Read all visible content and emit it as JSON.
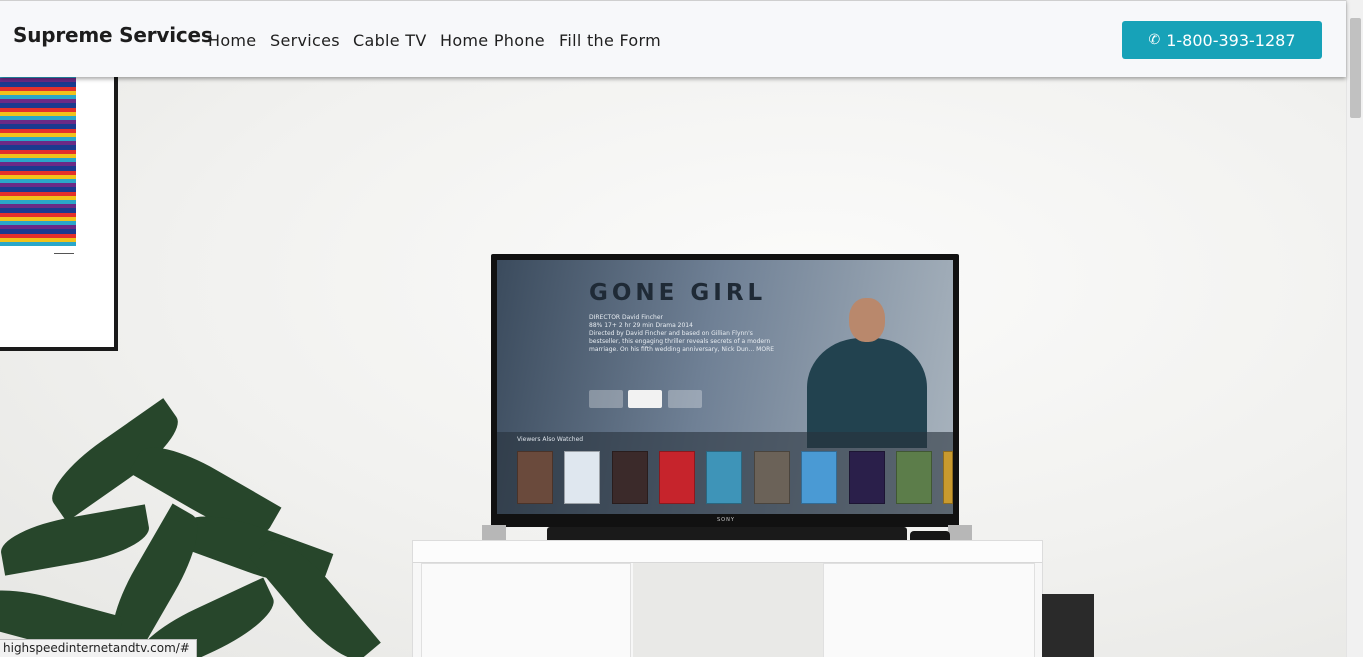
{
  "navbar": {
    "brand": "Supreme Services",
    "links": [
      "Home",
      "Services",
      "Cable TV",
      "Home Phone",
      "Fill the Form"
    ],
    "phone": "1-800-393-1287"
  },
  "hero": {
    "tv_title": "GONE GIRL",
    "tv_meta_lines": [
      "DIRECTOR  David Fincher",
      "88%  17+  2 hr 29 min  Drama  2014",
      "Directed by David Fincher and based on Gillian Flynn's",
      "bestseller, this engaging thriller reveals secrets of a modern",
      "marriage. On his fifth wedding anniversary, Nick Dun... MORE"
    ],
    "shelf_label": "Viewers Also Watched",
    "tv_brand": "SONY"
  },
  "status_url": "highspeedinternetandtv.com/#",
  "colors": {
    "accent": "#17a2b8",
    "navbar_bg": "#f7f8fa"
  }
}
